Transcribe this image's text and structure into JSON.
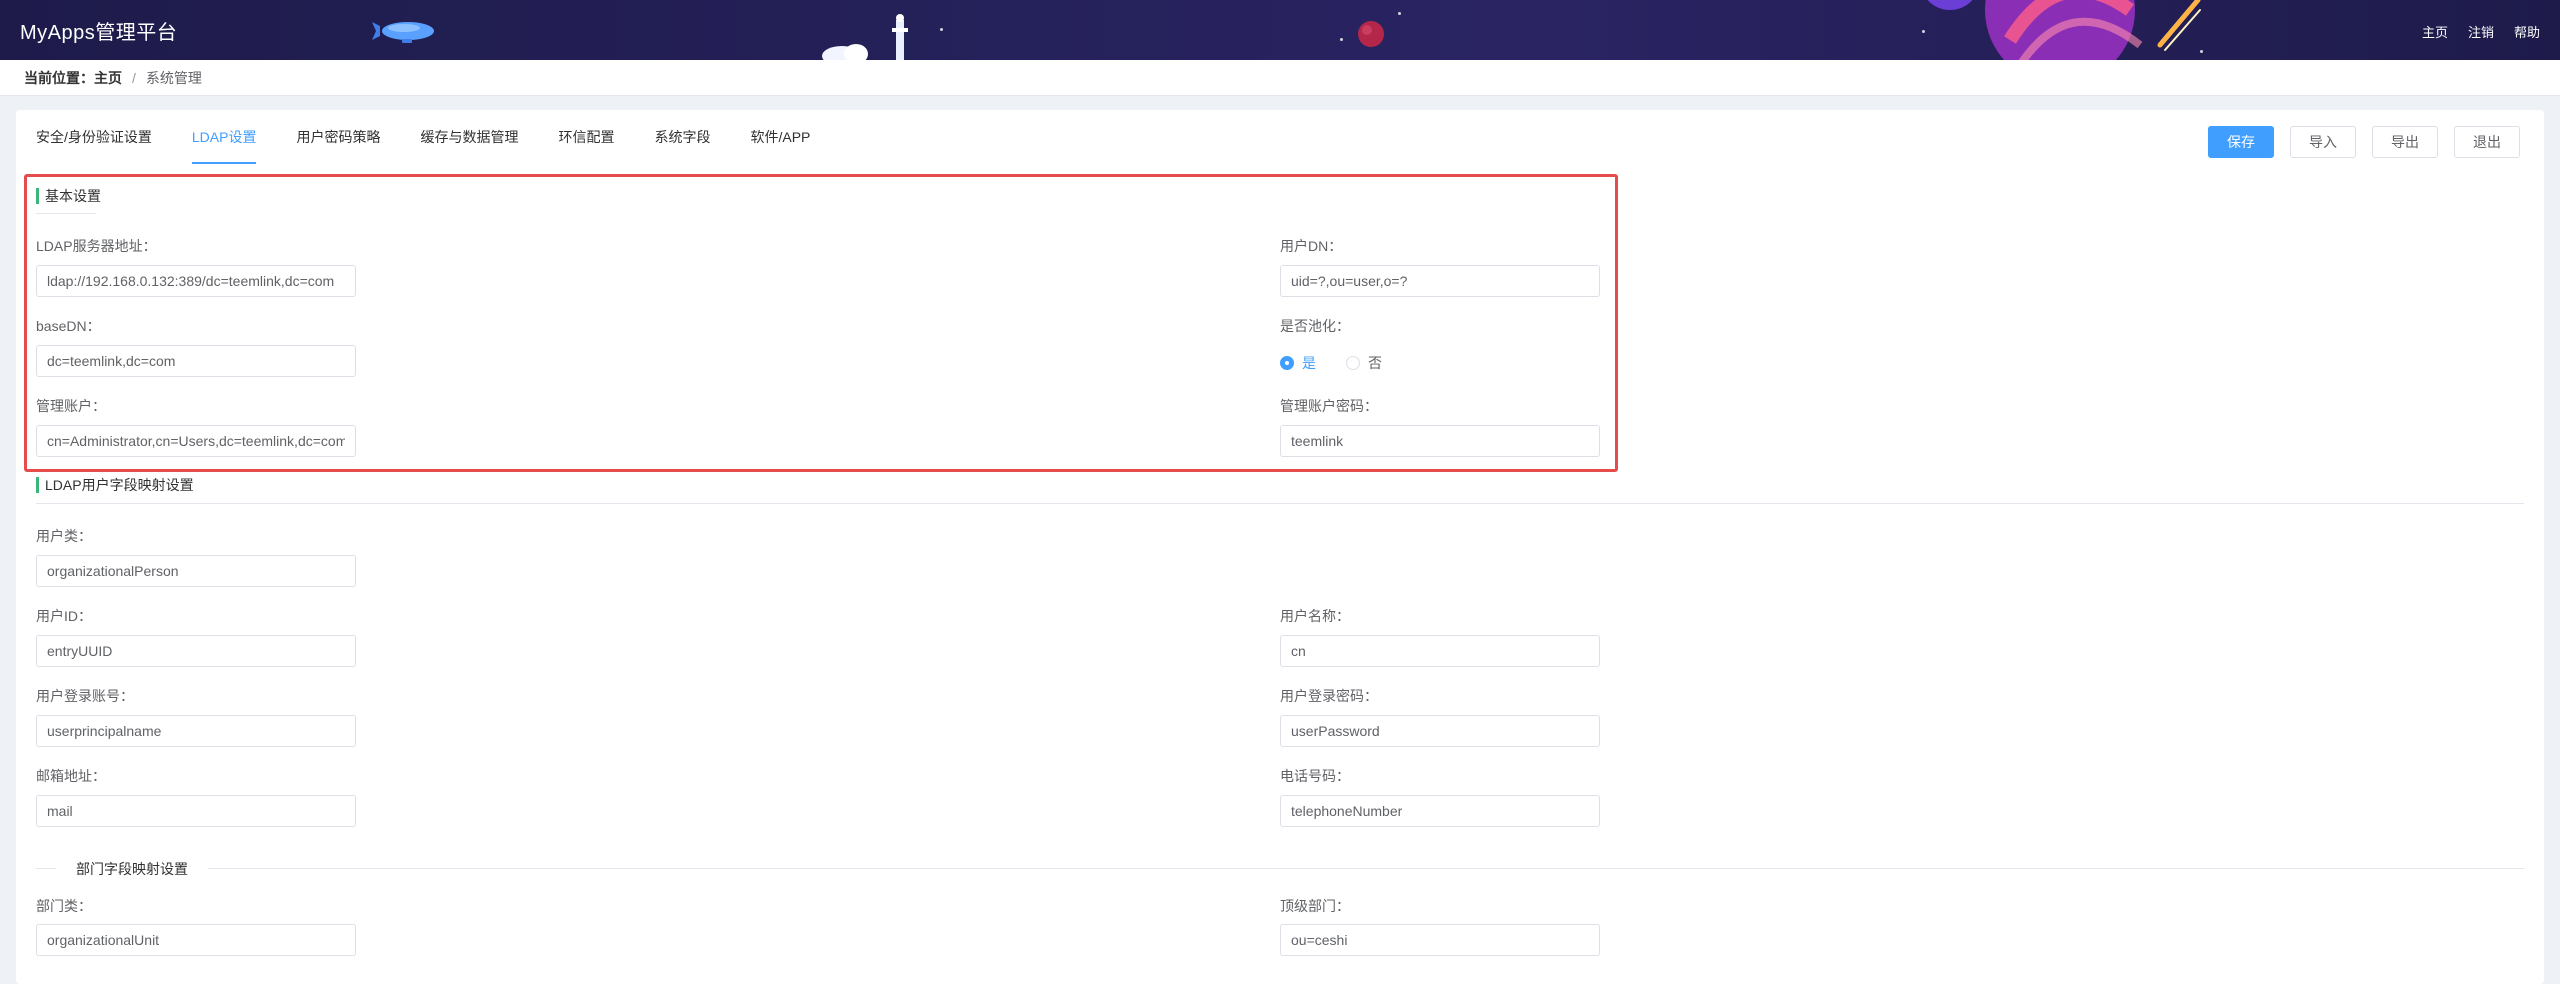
{
  "header": {
    "title": "MyApps管理平台",
    "nav": [
      "主页",
      "注销",
      "帮助"
    ]
  },
  "breadcrumb": {
    "label": "当前位置：",
    "home": "主页",
    "separator": "/",
    "current": "系统管理"
  },
  "tabs": [
    {
      "label": "安全/身份验证设置",
      "active": false
    },
    {
      "label": "LDAP设置",
      "active": true
    },
    {
      "label": "用户密码策略",
      "active": false
    },
    {
      "label": "缓存与数据管理",
      "active": false
    },
    {
      "label": "环信配置",
      "active": false
    },
    {
      "label": "系统字段",
      "active": false
    },
    {
      "label": "软件/APP",
      "active": false
    }
  ],
  "toolbar": {
    "save": "保存",
    "import": "导入",
    "export": "导出",
    "exit": "退出"
  },
  "basic": {
    "title": "基本设置",
    "server_label": "LDAP服务器地址：",
    "server_value": "ldap://192.168.0.132:389/dc=teemlink,dc=com",
    "user_dn_label": "用户DN：",
    "user_dn_value": "uid=?,ou=user,o=?",
    "base_dn_label": "baseDN：",
    "base_dn_value": "dc=teemlink,dc=com",
    "pool_label": "是否池化：",
    "pool_yes": "是",
    "pool_no": "否",
    "admin_label": "管理账户：",
    "admin_value": "cn=Administrator,cn=Users,dc=teemlink,dc=com",
    "admin_pwd_label": "管理账户密码：",
    "admin_pwd_value": "teemlink"
  },
  "mapping": {
    "title": "LDAP用户字段映射设置",
    "user_class_label": "用户类：",
    "user_class_value": "organizationalPerson",
    "user_id_label": "用户ID：",
    "user_id_value": "entryUUID",
    "user_name_label": "用户名称：",
    "user_name_value": "cn",
    "login_label": "用户登录账号：",
    "login_value": "userprincipalname",
    "login_pwd_label": "用户登录密码：",
    "login_pwd_value": "userPassword",
    "email_label": "邮箱地址：",
    "email_value": "mail",
    "phone_label": "电话号码：",
    "phone_value": "telephoneNumber"
  },
  "dept": {
    "title": "部门字段映射设置",
    "class_label": "部门类：",
    "class_value": "organizationalUnit",
    "top_label": "顶级部门：",
    "top_value": "ou=ceshi"
  }
}
